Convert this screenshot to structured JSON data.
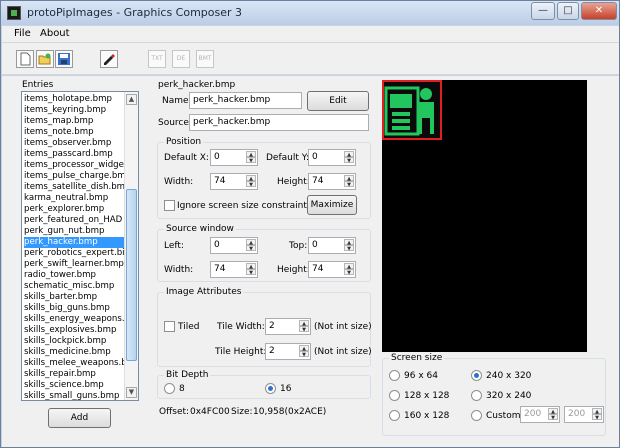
{
  "window": {
    "title": "protoPipImages - Graphics Composer 3",
    "minimize_glyph": "—",
    "maximize_glyph": "□",
    "close_glyph": "✕"
  },
  "menu": [
    "File",
    "About"
  ],
  "toolbar": {
    "new_icon": "new-file-icon",
    "open_icon": "open-folder-icon",
    "save_icon": "save-disk-icon",
    "edit_icon": "edit-pencil-icon",
    "disabled_buttons": [
      "TXT",
      "DE",
      "BMT"
    ]
  },
  "entries": {
    "title": "Entries",
    "items": [
      "items_holotape.bmp",
      "items_keyring.bmp",
      "items_map.bmp",
      "items_note.bmp",
      "items_observer.bmp",
      "items_passcard.bmp",
      "items_processor_widget",
      "items_pulse_charge.bmp",
      "items_satellite_dish.bmp",
      "karma_neutral.bmp",
      "perk_explorer.bmp",
      "perk_featured_on_HAD",
      "perk_gun_nut.bmp",
      "perk_hacker.bmp",
      "perk_robotics_expert.bi",
      "perk_swift_learner.bmp",
      "radio_tower.bmp",
      "schematic_misc.bmp",
      "skills_barter.bmp",
      "skills_big_guns.bmp",
      "skills_energy_weapons.l",
      "skills_explosives.bmp",
      "skills_lockpick.bmp",
      "skills_medicine.bmp",
      "skills_melee_weapons.bi",
      "skills_repair.bmp",
      "skills_science.bmp",
      "skills_small_guns.bmp"
    ],
    "selected_index": 13,
    "add_label": "Add"
  },
  "details": {
    "header": "perk_hacker.bmp",
    "name_label": "Name:",
    "name_value": "perk_hacker.bmp",
    "edit_label": "Edit",
    "source_label": "Source:",
    "source_value": "perk_hacker.bmp"
  },
  "position": {
    "title": "Position",
    "default_x_label": "Default X:",
    "default_x": "0",
    "default_y_label": "Default Y:",
    "default_y": "0",
    "width_label": "Width:",
    "width": "74",
    "height_label": "Height:",
    "height": "74",
    "ignore_label": "Ignore screen size constraints",
    "ignore_checked": false,
    "maximize_label": "Maximize"
  },
  "source_window": {
    "title": "Source window",
    "left_label": "Left:",
    "left": "0",
    "top_label": "Top:",
    "top": "0",
    "width_label": "Width:",
    "width": "74",
    "height_label": "Height:",
    "height": "74"
  },
  "image_attributes": {
    "title": "Image Attributes",
    "tiled_label": "Tiled",
    "tiled_checked": false,
    "tile_width_label": "Tile Width:",
    "tile_width": "2",
    "tile_height_label": "Tile Height:",
    "tile_height": "2",
    "not_int_note": "(Not int size)"
  },
  "bit_depth": {
    "title": "Bit Depth",
    "options": [
      "8",
      "16"
    ],
    "selected": "16"
  },
  "status": {
    "offset_label": "Offset:",
    "offset_value": "0x4FC00",
    "size_label": "Size:",
    "size_value": "10,958(0x2ACE)"
  },
  "screen_size": {
    "title": "Screen size",
    "options": [
      "96 x 64",
      "240 x 320",
      "128 x 128",
      "320 x 240",
      "160 x 128",
      "Custom"
    ],
    "selected": "240 x 320",
    "custom_w": "200",
    "custom_h": "200"
  },
  "colors": {
    "preview_bg": "#000000",
    "sprite_green": "#22c55e",
    "sprite_border": "#e02020",
    "selection": "#3399ff"
  }
}
